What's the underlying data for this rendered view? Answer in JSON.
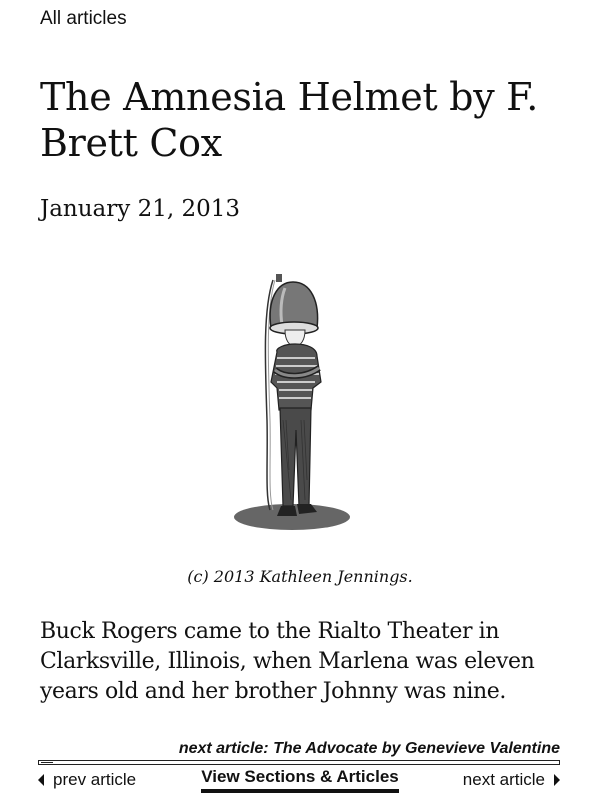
{
  "nav": {
    "all_articles": "All articles"
  },
  "article": {
    "title": "The Amnesia Helmet by F. Brett Cox",
    "date": "January 21, 2013",
    "caption": "(c) 2013 Kathleen Jennings.",
    "body": "Buck Rogers came to the Rialto Theater in Clarksville, Illinois, when Marlena was eleven years old and her brother Johnny was nine."
  },
  "footer": {
    "next_article": "next article: The Advocate by Genevieve Valentine",
    "prev_label": "prev article",
    "view_sections": "View Sections & Articles",
    "next_label": "next article"
  },
  "icons": {
    "prev": "triangle-left-icon",
    "next": "triangle-right-icon"
  },
  "colors": {
    "text": "#111111",
    "background": "#ffffff"
  }
}
